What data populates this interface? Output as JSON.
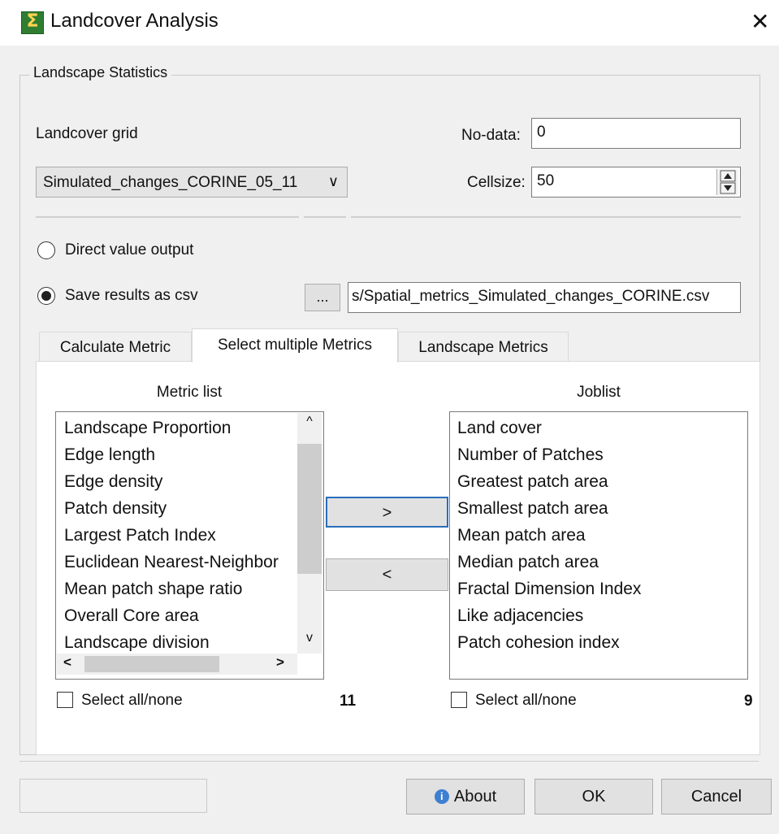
{
  "window": {
    "title": "Landcover Analysis",
    "close_glyph": "✕"
  },
  "group": {
    "title": "Landscape Statistics"
  },
  "landcover": {
    "label": "Landcover grid",
    "selected": "Simulated_changes_CORINE_05_11",
    "arrow": "∨"
  },
  "nodata": {
    "label": "No-data:",
    "value": "0"
  },
  "cellsize": {
    "label": "Cellsize:",
    "value": "50"
  },
  "output": {
    "direct_label": "Direct value output",
    "csv_label": "Save results as csv",
    "browse_label": "...",
    "path_value": "s/Spatial_metrics_Simulated_changes_CORINE.csv",
    "selected": "csv"
  },
  "tabs": [
    {
      "label": "Calculate Metric"
    },
    {
      "label": "Select multiple Metrics"
    },
    {
      "label": "Landscape Metrics"
    }
  ],
  "metric_list": {
    "header": "Metric list",
    "items": [
      "Landscape Proportion",
      "Edge length",
      "Edge density",
      "Patch density",
      "Largest Patch Index",
      "Euclidean Nearest-Neighbor",
      "Mean patch shape ratio",
      "Overall Core area",
      "Landscape division"
    ],
    "select_all_label": "Select all/none",
    "count": "11"
  },
  "joblist": {
    "header": "Joblist",
    "items": [
      "Land cover",
      "Number of Patches",
      "Greatest patch area",
      "Smallest patch area",
      "Mean patch area",
      "Median patch area",
      "Fractal Dimension Index",
      "Like adjacencies",
      "Patch cohesion index"
    ],
    "select_all_label": "Select all/none",
    "count": "9"
  },
  "transfer": {
    "add_label": ">",
    "remove_label": "<"
  },
  "scroll_glyphs": {
    "up": "^",
    "down": "v",
    "left": "<",
    "right": ">"
  },
  "footer": {
    "about_label": "About",
    "ok_label": "OK",
    "cancel_label": "Cancel",
    "info_glyph": "i"
  },
  "icons": {
    "app": "sigma-map-icon",
    "close": "close-icon",
    "info": "info-icon",
    "spin_up": "spin-up-icon",
    "spin_down": "spin-down-icon"
  },
  "colors": {
    "focus_border": "#2a6ebb",
    "info_blue": "#3f7fd1",
    "app_icon_green": "#2f7d32"
  }
}
